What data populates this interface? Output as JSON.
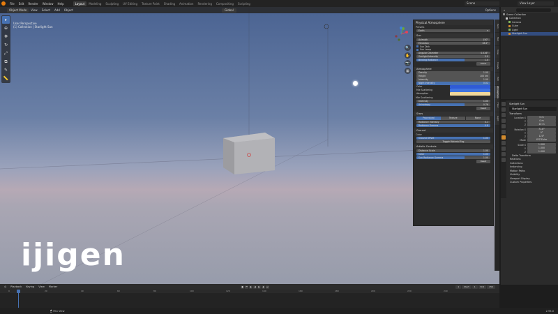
{
  "topbar": {
    "menu": [
      "File",
      "Edit",
      "Render",
      "Window",
      "Help"
    ],
    "workspaces": [
      "Layout",
      "Modeling",
      "Sculpting",
      "UV Editing",
      "Texture Paint",
      "Shading",
      "Animation",
      "Rendering",
      "Compositing",
      "Scripting"
    ],
    "active_workspace": "Layout",
    "scene": "Scene",
    "view_layer": "View Layer"
  },
  "viewport": {
    "mode": "Object Mode",
    "menus": [
      "View",
      "Select",
      "Add",
      "Object"
    ],
    "transform_orientation": "Global",
    "options_label": "Options",
    "info_line1": "User Perspective",
    "info_line2": "(1) Collection | Starlight Sun",
    "logo_text": "ijigen"
  },
  "physical_atmosphere": {
    "title": "Physical Atmosphere",
    "presets_label": "Presets",
    "preset_value": "Earth",
    "sun": {
      "title": "Sun",
      "azimuth_label": "Azimuth",
      "azimuth_value": "150°",
      "elevation_label": "Elevation",
      "elevation_value": "18.2°",
      "sun_disk_label": "Sun Disk",
      "sun_lamp_label": "Sun Lamp",
      "angular_diameter_label": "Angular Diameter",
      "angular_diameter_value": "0.526°",
      "intensity_label": "Sunlight Intensity",
      "intensity_value": "5.0",
      "radiance_label": "Binding Radiance",
      "radiance_value": "1.0",
      "reset_label": "Reset"
    },
    "atmosphere": {
      "title": "Atmosphere",
      "density_label": "Density",
      "density_value": "1.00",
      "height_label": "Height",
      "height_value": "100 km",
      "intensity_label": "Intensity",
      "intensity_value": "1.00",
      "night_label": "Night Intensity",
      "night_value": "0.02",
      "color_label": "Color",
      "mie_label": "Mie Scattering",
      "absorption_label": "Absorption",
      "mie2_label": "Mie Scattering",
      "mie_intensity_label": "Intensity",
      "mie_intensity_value": "1.00",
      "anisotropy_label": "Anisotropy",
      "anisotropy_value": "0.76",
      "reset_label": "Reset",
      "colors": {
        "color": "#2f5bd6",
        "mie": "#3f73e0",
        "absorption": "#f1d79a"
      }
    },
    "stars": {
      "title": "Stars",
      "options": [
        "Procedural",
        "Texture",
        "None"
      ],
      "active_option": "Procedural",
      "radiance_label": "Radiance Intensity",
      "radiance_value": "0.1",
      "amount_label": "Radiance Gamma",
      "amount_value": "0.8"
    },
    "ground": {
      "title": "Ground",
      "color_label": "Color",
      "offset_label": "Ground Offset",
      "offset_value": "1.00",
      "toggle_label": "Toggle Material Fog"
    },
    "artistic": {
      "title": "Artistic Controls",
      "distance_label": "Distance Scale",
      "distance_value": "1.00",
      "color_label": "Color",
      "color_value": "1.00",
      "sun_radiance_label": "Sun Radiance Gamma",
      "sun_radiance_value": "1.00",
      "reset_label": "Reset"
    }
  },
  "sidebar_tabs": [
    "Item",
    "Tool",
    "View",
    "Create",
    "Edit",
    "Atmosphere",
    "Fluid",
    "Light"
  ],
  "active_sidebar_tab": "Atmosphere",
  "outliner": {
    "title": "Scene Collection",
    "items": [
      {
        "label": "Collection",
        "color": "#cfcfcf",
        "selected": false
      },
      {
        "label": "Camera",
        "color": "#84b85c",
        "selected": false
      },
      {
        "label": "Cube",
        "color": "#d38b2d",
        "selected": false
      },
      {
        "label": "Light",
        "color": "#84b85c",
        "selected": false
      },
      {
        "label": "Starlight Sun",
        "color": "#d38b2d",
        "selected": true
      }
    ]
  },
  "properties": {
    "object_label": "Starlight Sun",
    "name_value": "Starlight Sun",
    "transform_label": "Transform",
    "location_label": "Location X",
    "rotation_label": "Rotation X",
    "scale_label": "Scale X",
    "mode_label": "Mode",
    "mode_value": "XYZ Euler",
    "location": [
      "0 m",
      "0 m",
      "10 m"
    ],
    "rotation": [
      "71.8°",
      "0°",
      "120°"
    ],
    "scale": [
      "1.000",
      "1.000",
      "1.000"
    ],
    "y_label": "Y",
    "z_label": "Z",
    "delta_label": "Delta Transform",
    "collapsed": [
      "Relations",
      "Collections",
      "Instancing",
      "Motion Paths",
      "Visibility",
      "Viewport Display",
      "Custom Properties"
    ]
  },
  "timeline": {
    "menus": [
      "Playback",
      "Keying",
      "View",
      "Marker"
    ],
    "current_frame": "1",
    "start_label": "Start",
    "start_value": "1",
    "end_label": "End",
    "end_value": "250",
    "ruler": [
      "0",
      "20",
      "40",
      "60",
      "80",
      "100",
      "120",
      "140",
      "160",
      "180",
      "200",
      "220",
      "240"
    ]
  },
  "statusbar": {
    "hint": "Pan View",
    "version": "2.93.0"
  }
}
